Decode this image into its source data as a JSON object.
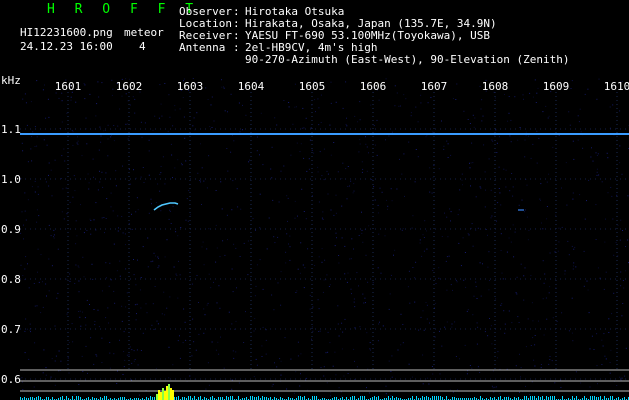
{
  "header": {
    "brand": "H R O F F T",
    "filename": "HI12231600.png",
    "datetime": "24.12.23 16:00",
    "meteor_label": "meteor",
    "meteor_count": "4",
    "observer_label": "Observer",
    "observer_value": "Hirotaka Otsuka",
    "location_label": "Location",
    "location_value": "Hirakata, Osaka, Japan (135.7E, 34.9N)",
    "receiver_label": "Receiver",
    "receiver_value": "YAESU FT-690 53.100MHz(Toyokawa), USB",
    "antenna_label": "Antenna",
    "antenna_value": "2el-HB9CV, 4m's high",
    "antenna_value2": "90-270-Azimuth (East-West), 90-Elevation (Zenith)"
  },
  "chart_data": {
    "type": "heatmap",
    "ylabel": "kHz",
    "x_ticks": [
      "1601",
      "1602",
      "1603",
      "1604",
      "1605",
      "1606",
      "1607",
      "1608",
      "1609",
      "1610"
    ],
    "y_ticks": [
      "1.1",
      "1.0",
      "0.9",
      "0.8",
      "0.7",
      "0.6"
    ],
    "ylim": [
      0.6,
      1.1
    ],
    "carrier_khz": 1.09,
    "meteor_count": 4,
    "colors": {
      "background": "#000000",
      "carrier": "#3a9cff",
      "echo": "#4fc8ff",
      "baseline": "#00d8ff",
      "spike": "#ffff00"
    }
  }
}
